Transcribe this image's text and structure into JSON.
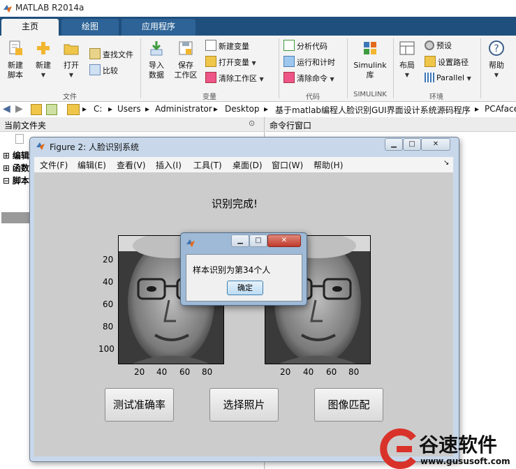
{
  "app": {
    "title": "MATLAB R2014a"
  },
  "tabs": [
    {
      "label": "主页",
      "active": true
    },
    {
      "label": "绘图",
      "active": false
    },
    {
      "label": "应用程序",
      "active": false
    }
  ],
  "ribbon": {
    "file": {
      "new_script": "新建\n脚本",
      "new": "新建",
      "open": "打开",
      "find_files": "查找文件",
      "compare": "比较",
      "section": "文件"
    },
    "variable": {
      "import_data": "导入\n数据",
      "save_workspace": "保存\n工作区",
      "new_variable": "新建变量",
      "open_variable": "打开变量",
      "clear_workspace": "清除工作区",
      "section": "变量"
    },
    "code": {
      "analyze_code": "分析代码",
      "run_and_time": "运行和计时",
      "clear_commands": "清除命令",
      "section": "代码"
    },
    "simulink": {
      "library": "Simulink\n库",
      "section": "SIMULINK"
    },
    "environment": {
      "layout": "布局",
      "preferences": "预设",
      "set_path": "设置路径",
      "parallel": "Parallel",
      "section": "环境"
    },
    "help": {
      "label": "帮助"
    }
  },
  "address": {
    "segments": [
      "C:",
      "Users",
      "Administrator",
      "Desktop",
      "基于matlab编程人脸识别GUI界面设计系统源码程序",
      "PCAface"
    ]
  },
  "panes": {
    "current_folder": "当前文件夹",
    "command_window": "命令行窗口",
    "tree": [
      "编辑",
      "函数",
      "脚本"
    ]
  },
  "figure": {
    "title": "Figure 2: 人脸识别系统",
    "menu": [
      "文件(F)",
      "编辑(E)",
      "查看(V)",
      "插入(I)",
      "工具(T)",
      "桌面(D)",
      "窗口(W)",
      "帮助(H)"
    ],
    "status_text": "识别完成!",
    "axes_y_ticks": [
      "20",
      "40",
      "60",
      "80",
      "100"
    ],
    "axes_x_ticks": [
      "20",
      "40",
      "60",
      "80"
    ],
    "buttons": {
      "test_accuracy": "测试准确率",
      "select_photo": "选择照片",
      "image_match": "图像匹配"
    }
  },
  "dialog": {
    "message": "样本识别为第34个人",
    "ok": "确定"
  },
  "watermark": {
    "brand": "谷速软件",
    "url": "www.gususoft.com"
  },
  "colors": {
    "tabbar": "#1f4f7d",
    "ribbon": "#f3f3f3",
    "figure_bg": "#cccccc"
  }
}
